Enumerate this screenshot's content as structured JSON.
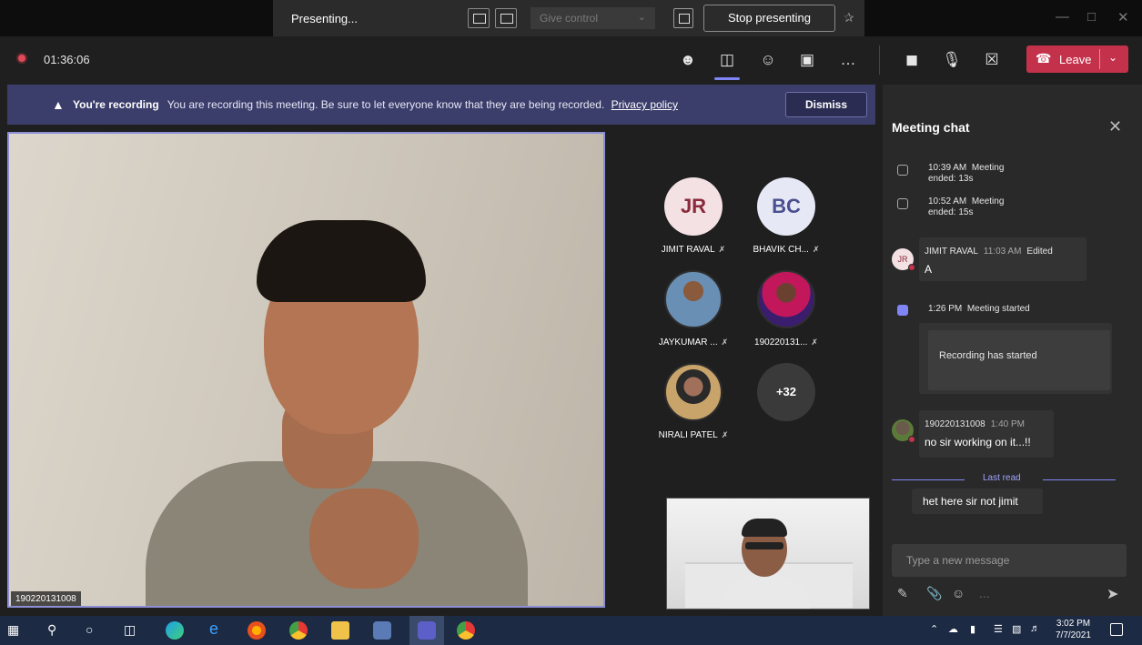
{
  "presenting_bar": {
    "status": "Presenting...",
    "give_control_label": "Give control",
    "stop_presenting_label": "Stop presenting"
  },
  "meeting_bar": {
    "recording_timer": "01:36:06",
    "leave_label": "Leave"
  },
  "recording_banner": {
    "title": "You're recording",
    "message": "You are recording this meeting. Be sure to let everyone know that they are being recorded.",
    "privacy_link": "Privacy policy",
    "dismiss_label": "Dismiss"
  },
  "main_video": {
    "participant_name": "190220131008"
  },
  "participants": [
    {
      "initials": "JR",
      "name": "JIMIT RAVAL"
    },
    {
      "initials": "BC",
      "name": "BHAVIK CH..."
    },
    {
      "initials": "",
      "name": "JAYKUMAR ..."
    },
    {
      "initials": "",
      "name": "190220131..."
    },
    {
      "initials": "",
      "name": "NIRALI PATEL"
    }
  ],
  "overflow_count": "+32",
  "chat": {
    "title": "Meeting chat",
    "system_events": [
      {
        "time": "10:39 AM",
        "text": "Meeting",
        "detail": "ended: 13s"
      },
      {
        "time": "10:52 AM",
        "text": "Meeting",
        "detail": "ended: 15s"
      }
    ],
    "message_1": {
      "avatar": "JR",
      "author": "JIMIT RAVAL",
      "time": "11:03 AM",
      "edited": "Edited",
      "body": "A"
    },
    "meeting_started": {
      "time": "1:26 PM",
      "text": "Meeting started"
    },
    "recording_card": "Recording has started",
    "message_2": {
      "author": "190220131008",
      "time": "1:40 PM",
      "body": "no sir working on it...!!"
    },
    "last_read": "Last read",
    "message_3": {
      "body": "het here sir not jimit"
    },
    "compose_placeholder": "Type a new message",
    "compose_more": "..."
  },
  "taskbar": {
    "time": "3:02 PM",
    "date": "7/7/2021"
  },
  "colors": {
    "accent": "#7f85f5",
    "leave": "#c4314b",
    "banner": "#3b3d6b",
    "taskbar": "#1c2a44",
    "panel": "#292929"
  },
  "icons": {
    "participants": "people-icon",
    "chat": "chat-icon",
    "reactions": "reactions-icon",
    "rooms": "breakout-rooms-icon",
    "more": "more-options-icon",
    "camera": "camera-icon",
    "mic": "microphone-icon",
    "share": "share-tray-icon"
  }
}
